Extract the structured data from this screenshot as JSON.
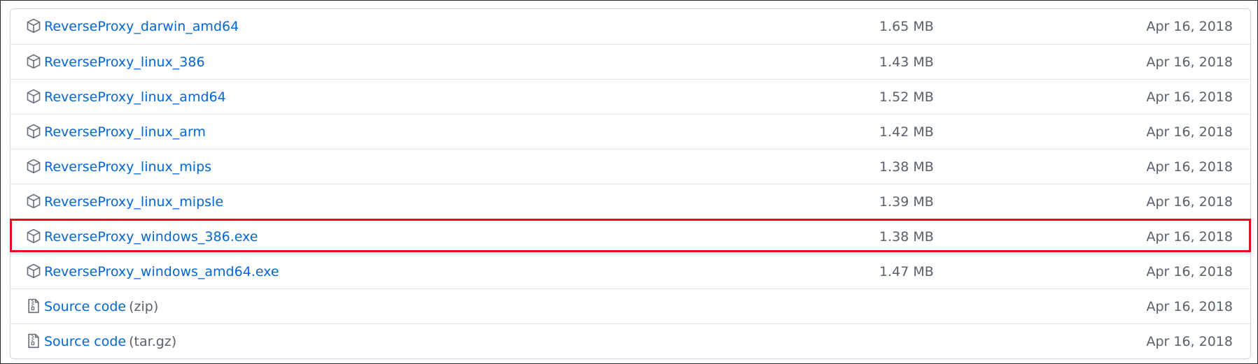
{
  "assets": [
    {
      "name": "ReverseProxy_darwin_amd64",
      "size": "1.65 MB",
      "date": "Apr 16, 2018",
      "icon": "package-icon"
    },
    {
      "name": "ReverseProxy_linux_386",
      "size": "1.43 MB",
      "date": "Apr 16, 2018",
      "icon": "package-icon"
    },
    {
      "name": "ReverseProxy_linux_amd64",
      "size": "1.52 MB",
      "date": "Apr 16, 2018",
      "icon": "package-icon"
    },
    {
      "name": "ReverseProxy_linux_arm",
      "size": "1.42 MB",
      "date": "Apr 16, 2018",
      "icon": "package-icon"
    },
    {
      "name": "ReverseProxy_linux_mips",
      "size": "1.38 MB",
      "date": "Apr 16, 2018",
      "icon": "package-icon"
    },
    {
      "name": "ReverseProxy_linux_mipsle",
      "size": "1.39 MB",
      "date": "Apr 16, 2018",
      "icon": "package-icon"
    },
    {
      "name": "ReverseProxy_windows_386.exe",
      "size": "1.38 MB",
      "date": "Apr 16, 2018",
      "icon": "package-icon",
      "highlighted": true
    },
    {
      "name": "ReverseProxy_windows_amd64.exe",
      "size": "1.47 MB",
      "date": "Apr 16, 2018",
      "icon": "package-icon"
    }
  ],
  "source": [
    {
      "label": "Source code",
      "ext": "(zip)",
      "date": "Apr 16, 2018",
      "icon": "file-zip-icon"
    },
    {
      "label": "Source code",
      "ext": "(tar.gz)",
      "date": "Apr 16, 2018",
      "icon": "file-zip-icon"
    }
  ],
  "colors": {
    "link": "#0366d6",
    "muted": "#586069",
    "highlight": "#e0101e",
    "border": "#e1e4e8"
  }
}
